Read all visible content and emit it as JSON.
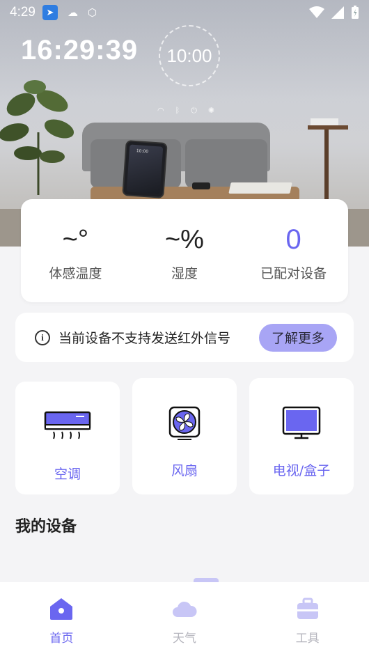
{
  "status_bar": {
    "time": "4:29"
  },
  "hero": {
    "clock": "16:29:39",
    "dial_time": "10:00"
  },
  "stats": [
    {
      "value": "~°",
      "label": "体感温度"
    },
    {
      "value": "~%",
      "label": "湿度"
    },
    {
      "value": "0",
      "label": "已配对设备"
    }
  ],
  "notice": {
    "text": "当前设备不支持发送红外信号",
    "button": "了解更多"
  },
  "devices": [
    {
      "label": "空调",
      "icon": "air-conditioner-icon"
    },
    {
      "label": "风扇",
      "icon": "fan-icon"
    },
    {
      "label": "电视/盒子",
      "icon": "tv-icon"
    }
  ],
  "my_devices": {
    "title": "我的设备"
  },
  "nav": [
    {
      "label": "首页",
      "icon": "home-icon",
      "active": true
    },
    {
      "label": "天气",
      "icon": "cloud-icon",
      "active": false
    },
    {
      "label": "工具",
      "icon": "toolbox-icon",
      "active": false
    }
  ],
  "colors": {
    "accent": "#6a66f0",
    "button_bg": "#a8a5f5",
    "inactive": "#b5b5bd",
    "background": "#f4f4f6"
  }
}
